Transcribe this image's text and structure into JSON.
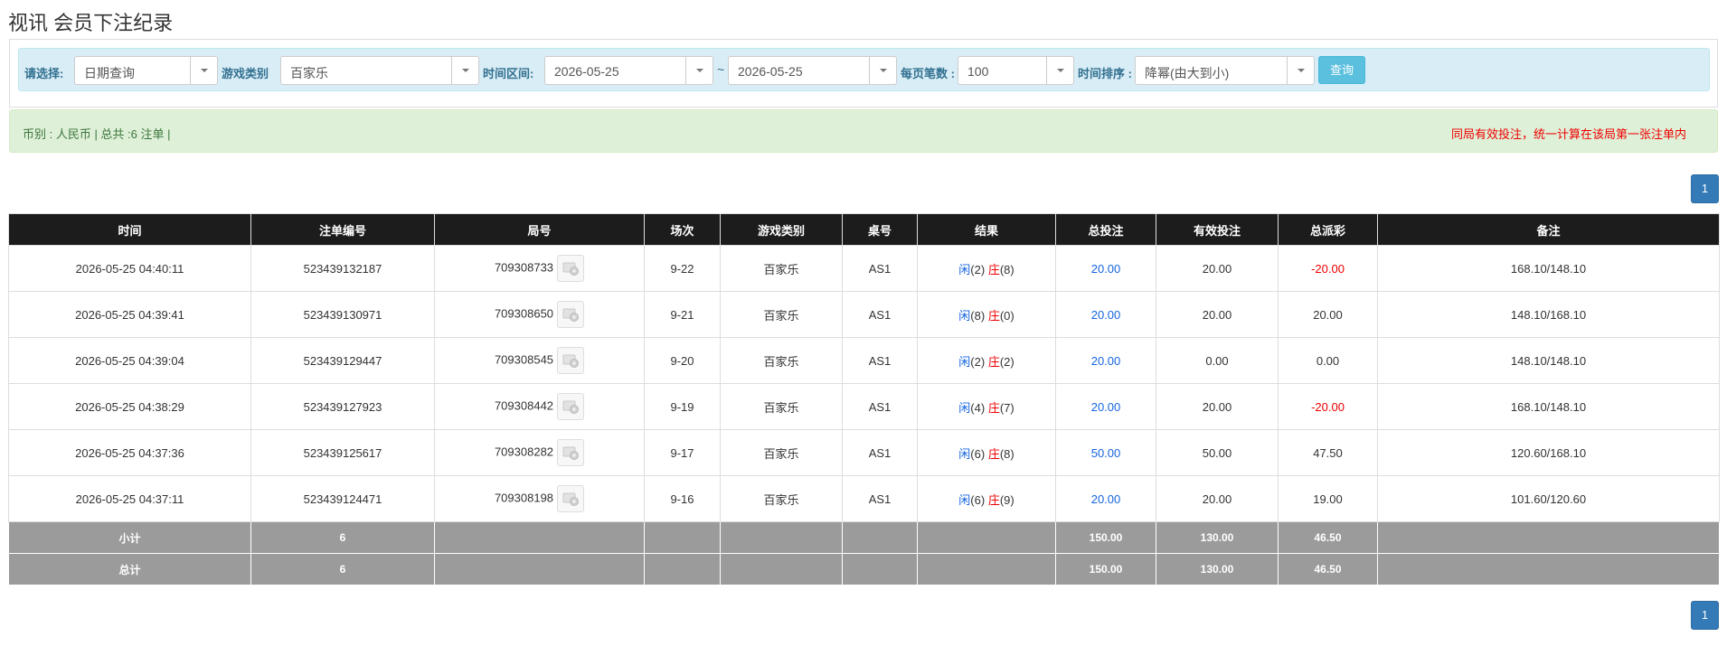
{
  "page": {
    "title": "视讯 会员下注纪录"
  },
  "filter": {
    "select_label": "请选择:",
    "select_value": "日期查询",
    "game_label": "游戏类别",
    "game_value": "百家乐",
    "range_label": "时间区间:",
    "date_from": "2026-05-25",
    "range_sep": "~",
    "date_to": "2026-05-25",
    "per_page_label": "每页笔数 :",
    "per_page_value": "100",
    "sort_label": "时间排序 :",
    "sort_value": "降幂(由大到小)",
    "query_button": "查询"
  },
  "info": {
    "summary": "币别 : 人民币 | 总共 :6 注单 |",
    "notice": "同局有效投注，统一计算在该局第一张注单内"
  },
  "pager": {
    "current": "1"
  },
  "table": {
    "headers": [
      "时间",
      "注单编号",
      "局号",
      "场次",
      "游戏类别",
      "桌号",
      "结果",
      "总投注",
      "有效投注",
      "总派彩",
      "备注"
    ],
    "rows": [
      {
        "time": "2026-05-25 04:40:11",
        "order": "523439132187",
        "round": "709308733",
        "session": "9-22",
        "game": "百家乐",
        "table": "AS1",
        "player_label": "闲",
        "player_score": "(2)",
        "banker_label": "庄",
        "banker_score": "(8)",
        "total": "20.00",
        "valid": "20.00",
        "payout": "-20.00",
        "payout_color": "#e00",
        "remark": "168.10/148.10"
      },
      {
        "time": "2026-05-25 04:39:41",
        "order": "523439130971",
        "round": "709308650",
        "session": "9-21",
        "game": "百家乐",
        "table": "AS1",
        "player_label": "闲",
        "player_score": "(8)",
        "banker_label": "庄",
        "banker_score": "(0)",
        "total": "20.00",
        "valid": "20.00",
        "payout": "20.00",
        "payout_color": "#333",
        "remark": "148.10/168.10"
      },
      {
        "time": "2026-05-25 04:39:04",
        "order": "523439129447",
        "round": "709308545",
        "session": "9-20",
        "game": "百家乐",
        "table": "AS1",
        "player_label": "闲",
        "player_score": "(2)",
        "banker_label": "庄",
        "banker_score": "(2)",
        "total": "20.00",
        "valid": "0.00",
        "payout": "0.00",
        "payout_color": "#333",
        "remark": "148.10/148.10"
      },
      {
        "time": "2026-05-25 04:38:29",
        "order": "523439127923",
        "round": "709308442",
        "session": "9-19",
        "game": "百家乐",
        "table": "AS1",
        "player_label": "闲",
        "player_score": "(4)",
        "banker_label": "庄",
        "banker_score": "(7)",
        "total": "20.00",
        "valid": "20.00",
        "payout": "-20.00",
        "payout_color": "#e00",
        "remark": "168.10/148.10"
      },
      {
        "time": "2026-05-25 04:37:36",
        "order": "523439125617",
        "round": "709308282",
        "session": "9-17",
        "game": "百家乐",
        "table": "AS1",
        "player_label": "闲",
        "player_score": "(6)",
        "banker_label": "庄",
        "banker_score": "(8)",
        "total": "50.00",
        "valid": "50.00",
        "payout": "47.50",
        "payout_color": "#333",
        "remark": "120.60/168.10"
      },
      {
        "time": "2026-05-25 04:37:11",
        "order": "523439124471",
        "round": "709308198",
        "session": "9-16",
        "game": "百家乐",
        "table": "AS1",
        "player_label": "闲",
        "player_score": "(6)",
        "banker_label": "庄",
        "banker_score": "(9)",
        "total": "20.00",
        "valid": "20.00",
        "payout": "19.00",
        "payout_color": "#333",
        "remark": "101.60/120.60"
      }
    ],
    "subtotal": {
      "label": "小计",
      "count": "6",
      "total": "150.00",
      "valid": "130.00",
      "payout": "46.50"
    },
    "grandtotal": {
      "label": "总计",
      "count": "6",
      "total": "150.00",
      "valid": "130.00",
      "payout": "46.50"
    }
  },
  "colors": {
    "player": "#1565e0",
    "banker": "#e00",
    "total": "#1565e0"
  },
  "icons": {
    "round_detail": "round-detail-icon",
    "dropdown": "chevron-down-icon"
  }
}
